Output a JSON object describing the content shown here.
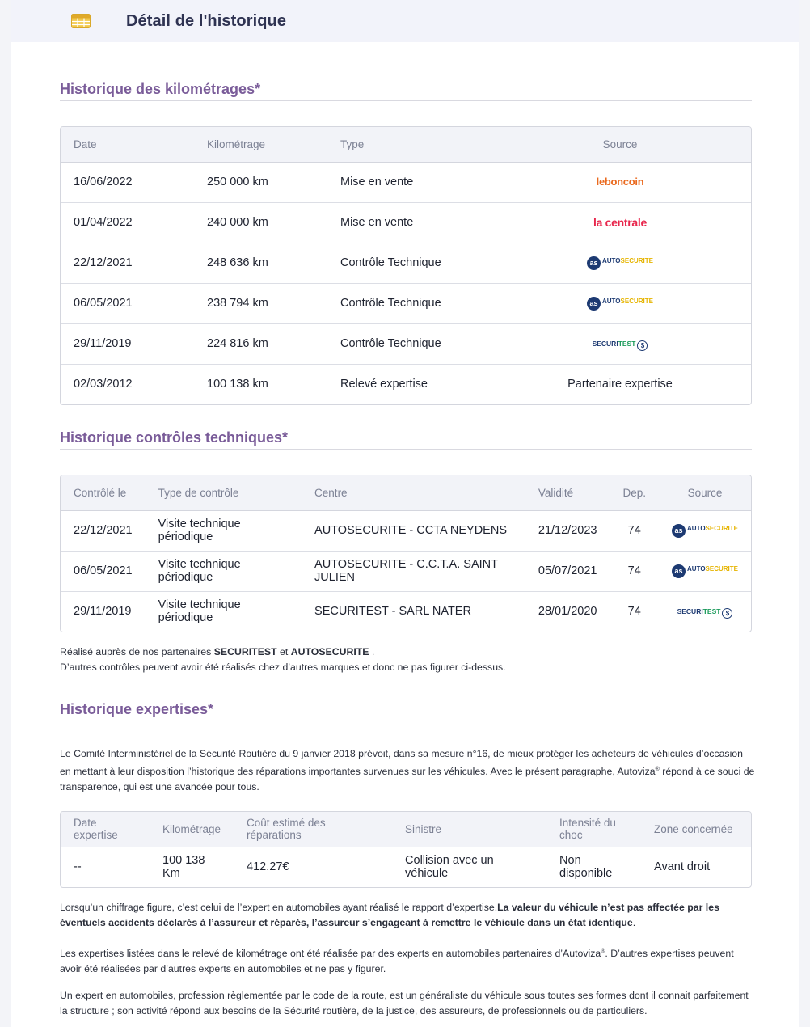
{
  "header": {
    "title": "Détail de l'historique",
    "icon": "table-icon"
  },
  "km_section": {
    "title": "Historique des kilométrages*",
    "columns": [
      "Date",
      "Kilométrage",
      "Type",
      "Source"
    ],
    "rows": [
      {
        "date": "16/06/2022",
        "km": "250 000 km",
        "type": "Mise en vente",
        "source": "leboncoin",
        "source_kind": "lbc"
      },
      {
        "date": "01/04/2022",
        "km": "240 000 km",
        "type": "Mise en vente",
        "source": "la centrale",
        "source_kind": "lc"
      },
      {
        "date": "22/12/2021",
        "km": "248 636 km",
        "type": "Contrôle Technique",
        "source": "autosecurite",
        "source_kind": "as"
      },
      {
        "date": "06/05/2021",
        "km": "238 794 km",
        "type": "Contrôle Technique",
        "source": "autosecurite",
        "source_kind": "as"
      },
      {
        "date": "29/11/2019",
        "km": "224 816 km",
        "type": "Contrôle Technique",
        "source": "securitest",
        "source_kind": "st"
      },
      {
        "date": "02/03/2012",
        "km": "100 138 km",
        "type": "Relevé expertise",
        "source": "Partenaire expertise",
        "source_kind": "text"
      }
    ]
  },
  "ct_section": {
    "title": "Historique contrôles techniques*",
    "columns": [
      "Contrôlé le",
      "Type de contrôle",
      "Centre",
      "Validité",
      "Dep.",
      "Source"
    ],
    "rows": [
      {
        "date": "22/12/2021",
        "type": "Visite technique périodique",
        "centre": "AUTOSECURITE - CCTA NEYDENS",
        "validite": "21/12/2023",
        "dep": "74",
        "source": "autosecurite",
        "source_kind": "as"
      },
      {
        "date": "06/05/2021",
        "type": "Visite technique périodique",
        "centre": "AUTOSECURITE - C.C.T.A. SAINT JULIEN",
        "validite": "05/07/2021",
        "dep": "74",
        "source": "autosecurite",
        "source_kind": "as"
      },
      {
        "date": "29/11/2019",
        "type": "Visite technique périodique",
        "centre": "SECURITEST - SARL NATER",
        "validite": "28/01/2020",
        "dep": "74",
        "source": "securitest",
        "source_kind": "st"
      }
    ],
    "note_prefix": "Réalisé auprès de nos partenaires ",
    "note_p1": "SECURITEST",
    "note_and": " et ",
    "note_p2": "AUTOSECURITE",
    "note_end": " .",
    "note_line2": "D’autres contrôles peuvent avoir été réalisés chez d’autres marques et donc ne pas figurer ci-dessus."
  },
  "exp_section": {
    "title": "Historique expertises*",
    "intro_1": "Le Comité Interministériel de la Sécurité Routière du 9 janvier 2018 prévoit, dans sa mesure n°16, de mieux protéger les acheteurs de véhicules d’occasion en mettant à leur disposition l’historique des réparations importantes survenues sur les véhicules. Avec le présent paragraphe, Autoviza",
    "intro_sup": "®",
    "intro_2": " répond à ce souci de transparence, qui est une avancée pour tous.",
    "columns": [
      "Date expertise",
      "Kilométrage",
      "Coût estimé des réparations",
      "Sinistre",
      "Intensité du choc",
      "Zone concernée"
    ],
    "rows": [
      {
        "date": "--",
        "km": "100 138 Km",
        "cout": "412.27€",
        "sinistre": "Collision avec un véhicule",
        "intensite": "Non disponible",
        "zone": "Avant droit"
      }
    ],
    "p1_normal": "Lorsqu’un chiffrage figure, c’est celui de l’expert en automobiles ayant réalisé le rapport d’expertise.",
    "p1_bold": "La valeur du véhicule n’est pas affectée par les éventuels accidents déclarés à l’assureur et réparés, l’assureur s’engageant à remettre le véhicule dans un état identique",
    "p1_end": ".",
    "p2_a": "Les expertises listées dans le relevé de kilométrage ont été réalisée par des experts en automobiles partenaires d’Autoviza",
    "p2_sup": "®",
    "p2_b": ". D’autres expertises peuvent avoir été réalisées par d’autres experts en automobiles et ne pas y figurer.",
    "p3": "Un expert en automobiles, profession règlementée par le code de la route, est un généraliste du véhicule sous toutes ses formes dont il connait parfaitement la structure ; son activité répond aux besoins de la Sécurité routière, de la justice, des assureurs, de professionnels ou de particuliers."
  },
  "logos": {
    "lbc": "leboncoin",
    "lc": "la centrale",
    "as_circle": "as",
    "as_a": "AUTO",
    "as_b": "SECURITE",
    "st_a": "SECURI",
    "st_b": "TEST"
  }
}
